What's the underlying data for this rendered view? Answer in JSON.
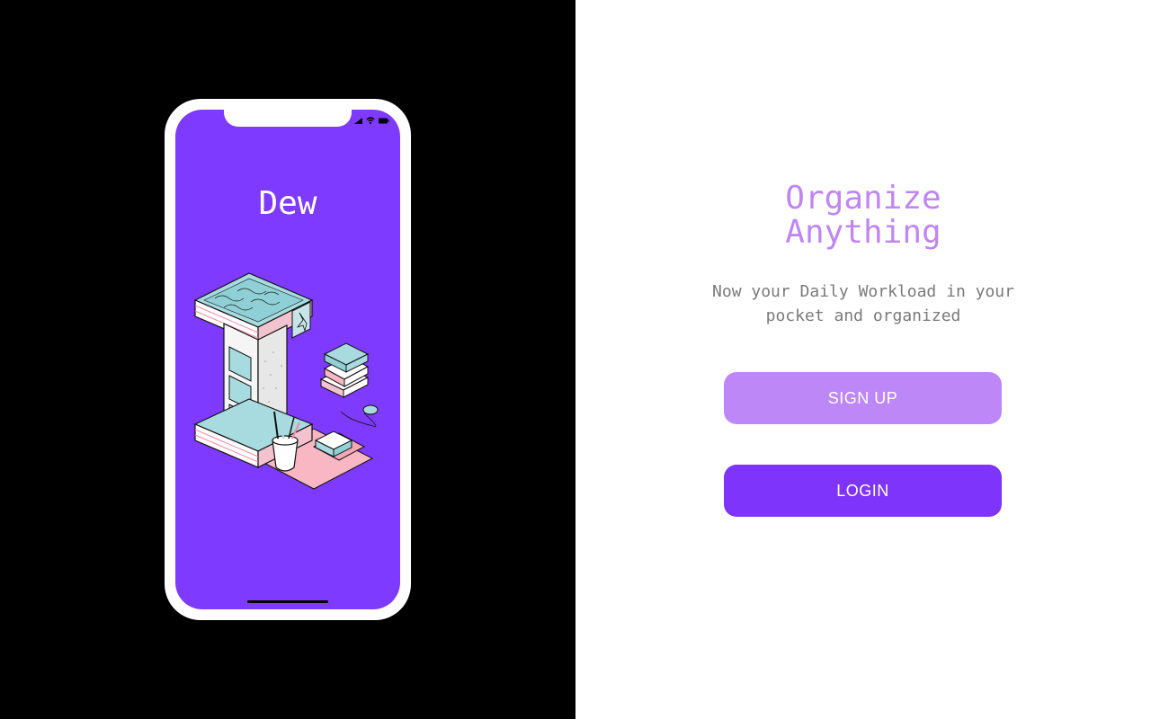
{
  "app": {
    "name": "Dew"
  },
  "onboarding": {
    "headline": "Organize\nAnything",
    "subtitle": "Now your Daily Workload in your pocket and organized",
    "signup_label": "SIGN UP",
    "login_label": "LOGIN"
  },
  "colors": {
    "accent_purple": "#7f3aff",
    "headline_lavender": "#bf86f4",
    "signup_button": "#bd87f8",
    "login_button": "#7f34fb",
    "left_background": "#000000",
    "right_background": "#ffffff"
  },
  "icons": {
    "status": [
      "signal-icon",
      "wifi-icon",
      "battery-icon"
    ],
    "illustration": "isometric-letter-i-desk-illustration"
  }
}
